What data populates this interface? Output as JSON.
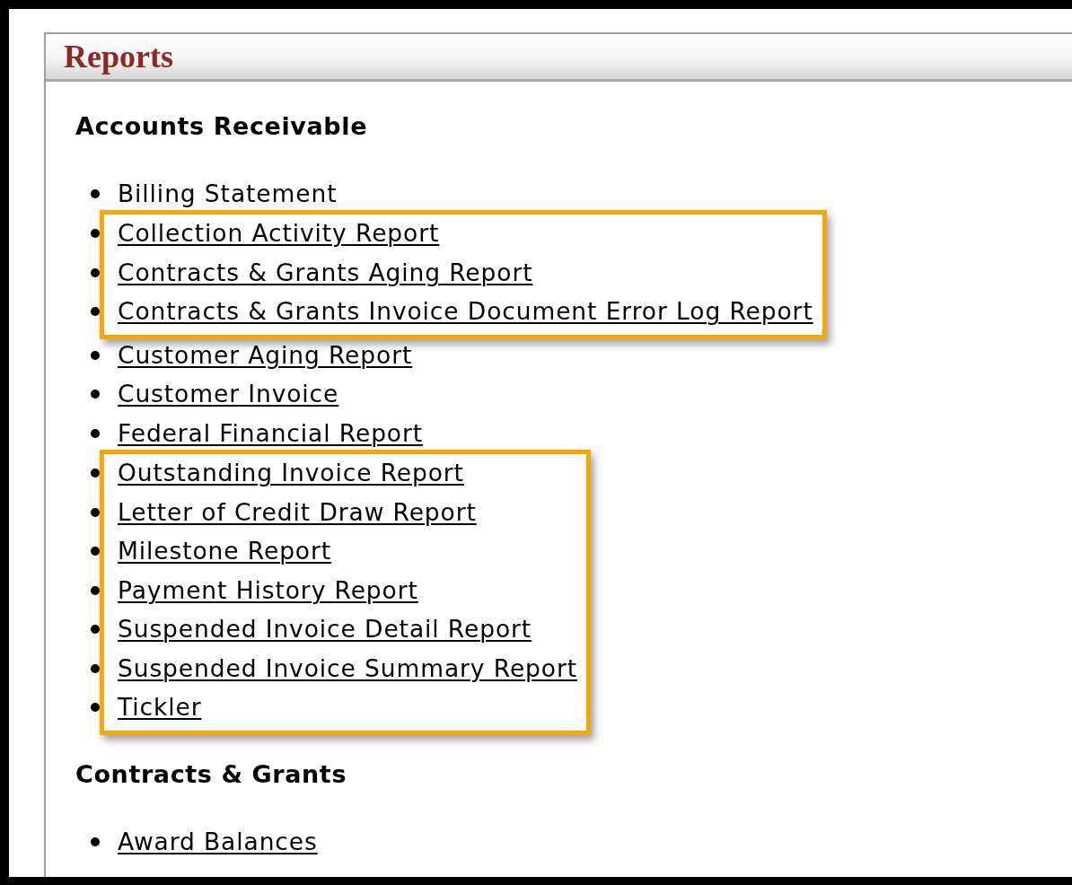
{
  "panel": {
    "title": "Reports"
  },
  "sections": [
    {
      "heading": "Accounts Receivable",
      "groups": [
        {
          "highlighted": false,
          "items": [
            {
              "label": "Billing Statement",
              "underlined": false
            }
          ]
        },
        {
          "highlighted": true,
          "items": [
            {
              "label": "Collection Activity Report",
              "underlined": true
            },
            {
              "label": "Contracts & Grants Aging Report",
              "underlined": true
            },
            {
              "label": "Contracts & Grants Invoice Document Error Log Report",
              "underlined": true
            }
          ]
        },
        {
          "highlighted": false,
          "items": [
            {
              "label": "Customer Aging Report",
              "underlined": true
            },
            {
              "label": "Customer Invoice",
              "underlined": true
            },
            {
              "label": "Federal Financial Report",
              "underlined": true
            }
          ]
        },
        {
          "highlighted": true,
          "items": [
            {
              "label": "Outstanding Invoice Report",
              "underlined": true
            },
            {
              "label": "Letter of Credit Draw Report",
              "underlined": true
            },
            {
              "label": "Milestone Report",
              "underlined": true
            },
            {
              "label": "Payment History Report",
              "underlined": true
            },
            {
              "label": "Suspended Invoice Detail Report",
              "underlined": true
            },
            {
              "label": "Suspended Invoice Summary Report",
              "underlined": true
            },
            {
              "label": "Tickler",
              "underlined": true
            }
          ]
        }
      ]
    },
    {
      "heading": "Contracts & Grants",
      "groups": [
        {
          "highlighted": false,
          "items": [
            {
              "label": "Award Balances",
              "underlined": true
            }
          ]
        }
      ]
    }
  ]
}
